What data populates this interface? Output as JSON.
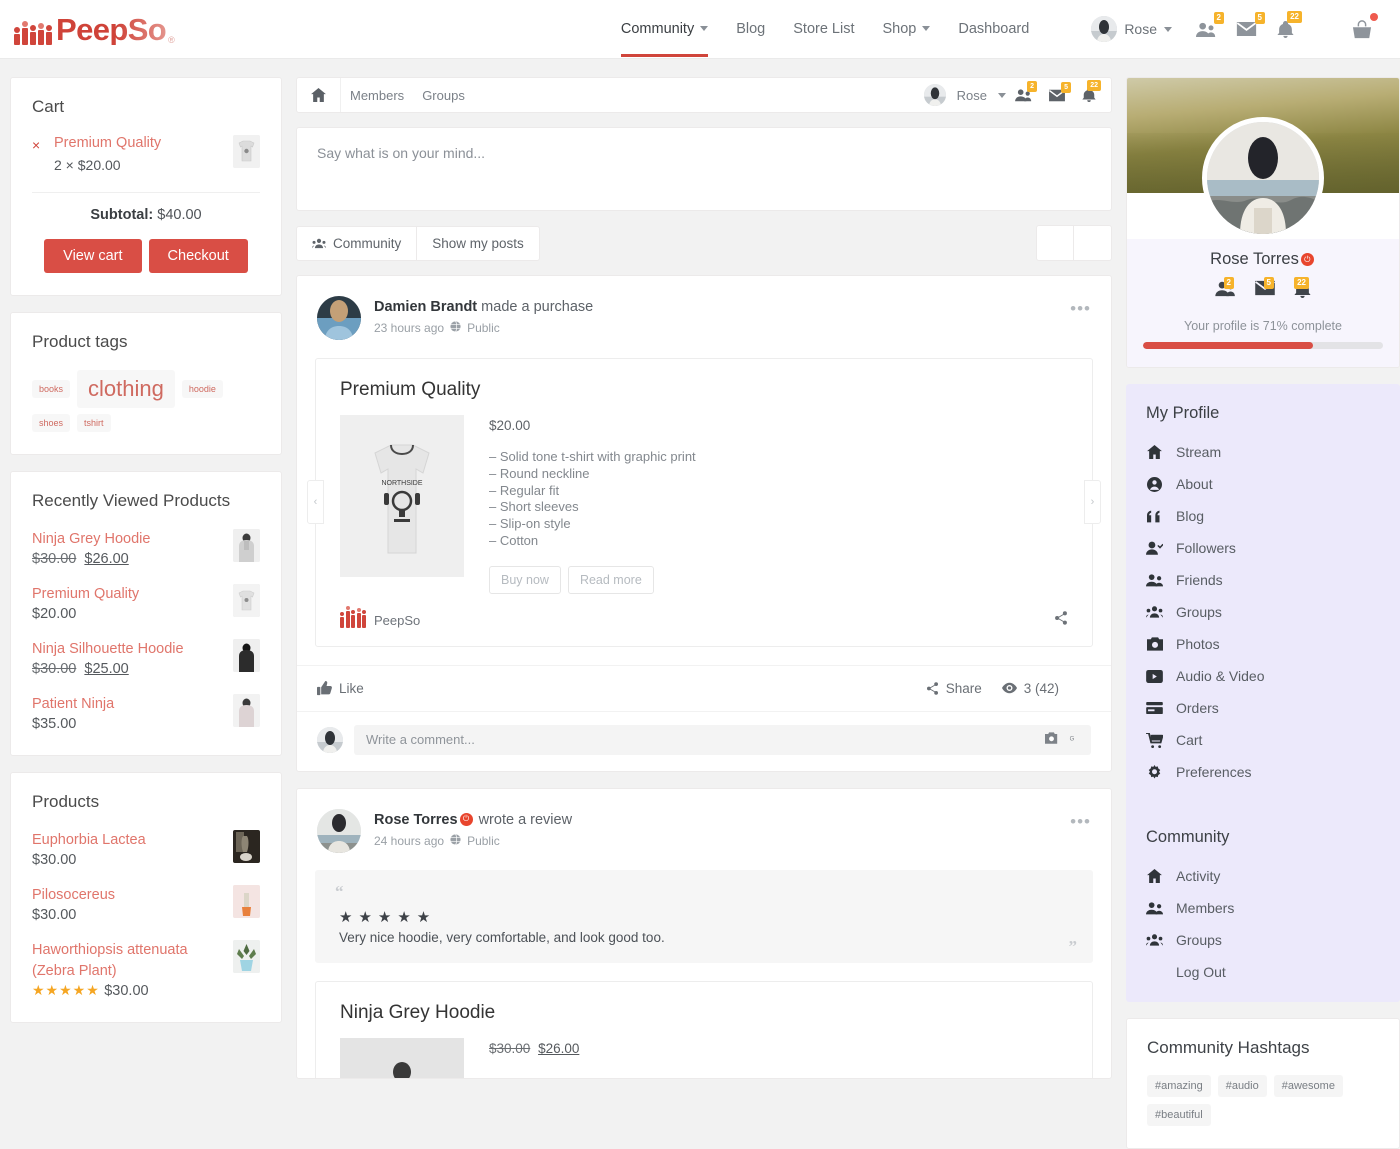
{
  "brand": {
    "name": "PeepSo",
    "registered": "®",
    "accent": "#d0453b",
    "accent_btn": "#d94e45",
    "badge_color": "#f6b32b"
  },
  "topnav": {
    "items": [
      {
        "label": "Community",
        "has_caret": true,
        "active": true
      },
      {
        "label": "Blog",
        "has_caret": false,
        "active": false
      },
      {
        "label": "Store List",
        "has_caret": false,
        "active": false
      },
      {
        "label": "Shop",
        "has_caret": true,
        "active": false
      },
      {
        "label": "Dashboard",
        "has_caret": false,
        "active": false
      }
    ],
    "user_name": "Rose",
    "icons": [
      {
        "name": "friends-icon",
        "badge": "2"
      },
      {
        "name": "messages-icon",
        "badge": "5"
      },
      {
        "name": "notifications-icon",
        "badge": "22"
      },
      {
        "name": "power-icon",
        "badge": ""
      },
      {
        "name": "cart-icon",
        "badge": "dot"
      }
    ]
  },
  "cart": {
    "title": "Cart",
    "item_name": "Premium Quality",
    "item_qty": "2 × $20.00",
    "remove_label": "×",
    "subtotal_label": "Subtotal:",
    "subtotal_value": "$40.00",
    "view_cart": "View cart",
    "checkout": "Checkout"
  },
  "product_tags": {
    "title": "Product tags",
    "tags": [
      {
        "label": "books",
        "size": "small"
      },
      {
        "label": "clothing",
        "size": "big"
      },
      {
        "label": "hoodie",
        "size": "small"
      },
      {
        "label": "shoes",
        "size": "small"
      },
      {
        "label": "tshirt",
        "size": "small"
      }
    ]
  },
  "recently_viewed": {
    "title": "Recently Viewed Products",
    "items": [
      {
        "name": "Ninja Grey Hoodie",
        "old_price": "$30.00",
        "price": "$26.00",
        "sale": true
      },
      {
        "name": "Premium Quality",
        "old_price": "",
        "price": "$20.00",
        "sale": false
      },
      {
        "name": "Ninja Silhouette Hoodie",
        "old_price": "$30.00",
        "price": "$25.00",
        "sale": true
      },
      {
        "name": "Patient Ninja",
        "old_price": "",
        "price": "$35.00",
        "sale": false
      }
    ]
  },
  "products": {
    "title": "Products",
    "items": [
      {
        "name": "Euphorbia Lactea",
        "price": "$30.00",
        "stars": ""
      },
      {
        "name": "Pilosocereus",
        "price": "$30.00",
        "stars": ""
      },
      {
        "name": "Haworthiopsis attenuata (Zebra Plant)",
        "price": "$30.00",
        "stars": "★★★★★"
      }
    ]
  },
  "feedbar": {
    "links": [
      "Members",
      "Groups"
    ],
    "user_name": "Rose",
    "icons": [
      {
        "name": "friends-icon",
        "badge": "2"
      },
      {
        "name": "messages-icon",
        "badge": "5"
      },
      {
        "name": "notifications-icon",
        "badge": "22"
      }
    ]
  },
  "composer": {
    "placeholder": "Say what is on your mind..."
  },
  "filters": {
    "community": "Community",
    "show_my_posts": "Show my posts"
  },
  "posts": [
    {
      "author": "Damien Brandt",
      "action": "made a purchase",
      "verified": false,
      "time": "23 hours ago",
      "privacy": "Public",
      "product": {
        "title": "Premium Quality",
        "price": "$20.00",
        "features": [
          "– Solid tone t-shirt with graphic print",
          "– Round neckline",
          "– Regular fit",
          "– Short sleeves",
          "– Slip-on style",
          "– Cotton"
        ],
        "buy_now": "Buy now",
        "read_more": "Read more",
        "brand": "PeepSo"
      },
      "actions": {
        "like": "Like",
        "share": "Share",
        "views": "3 (42)"
      },
      "comment_placeholder": "Write a comment..."
    },
    {
      "author": "Rose Torres",
      "action": "wrote a review",
      "verified": true,
      "time": "24 hours ago",
      "privacy": "Public",
      "review": {
        "stars": "★★★★★",
        "text": "Very nice hoodie, very comfortable, and look good too."
      },
      "product": {
        "title": "Ninja Grey Hoodie",
        "old_price": "$30.00",
        "price": "$26.00"
      }
    }
  ],
  "profile": {
    "name": "Rose Torres",
    "verified": true,
    "completion_text": "Your profile is 71% complete",
    "completion_percent": 71,
    "icons": [
      {
        "name": "friends-icon",
        "badge": "2"
      },
      {
        "name": "messages-icon",
        "badge": "5"
      },
      {
        "name": "notifications-icon",
        "badge": "22"
      }
    ]
  },
  "my_profile_menu": {
    "title": "My Profile",
    "items": [
      {
        "label": "Stream",
        "icon": "home-icon"
      },
      {
        "label": "About",
        "icon": "user-circle-icon"
      },
      {
        "label": "Blog",
        "icon": "quote-icon"
      },
      {
        "label": "Followers",
        "icon": "user-check-icon"
      },
      {
        "label": "Friends",
        "icon": "users-icon"
      },
      {
        "label": "Groups",
        "icon": "group-icon"
      },
      {
        "label": "Photos",
        "icon": "camera-icon"
      },
      {
        "label": "Audio & Video",
        "icon": "video-icon"
      },
      {
        "label": "Orders",
        "icon": "card-icon"
      },
      {
        "label": "Cart",
        "icon": "cart-icon"
      },
      {
        "label": "Preferences",
        "icon": "gear-icon"
      }
    ]
  },
  "community_menu": {
    "title": "Community",
    "items": [
      {
        "label": "Activity",
        "icon": "home-icon"
      },
      {
        "label": "Members",
        "icon": "users-icon"
      },
      {
        "label": "Groups",
        "icon": "group-icon"
      },
      {
        "label": "Log Out",
        "icon": "power-icon"
      }
    ]
  },
  "hashtags": {
    "title": "Community Hashtags",
    "items": [
      "#amazing",
      "#audio",
      "#awesome",
      "#beautiful"
    ]
  }
}
